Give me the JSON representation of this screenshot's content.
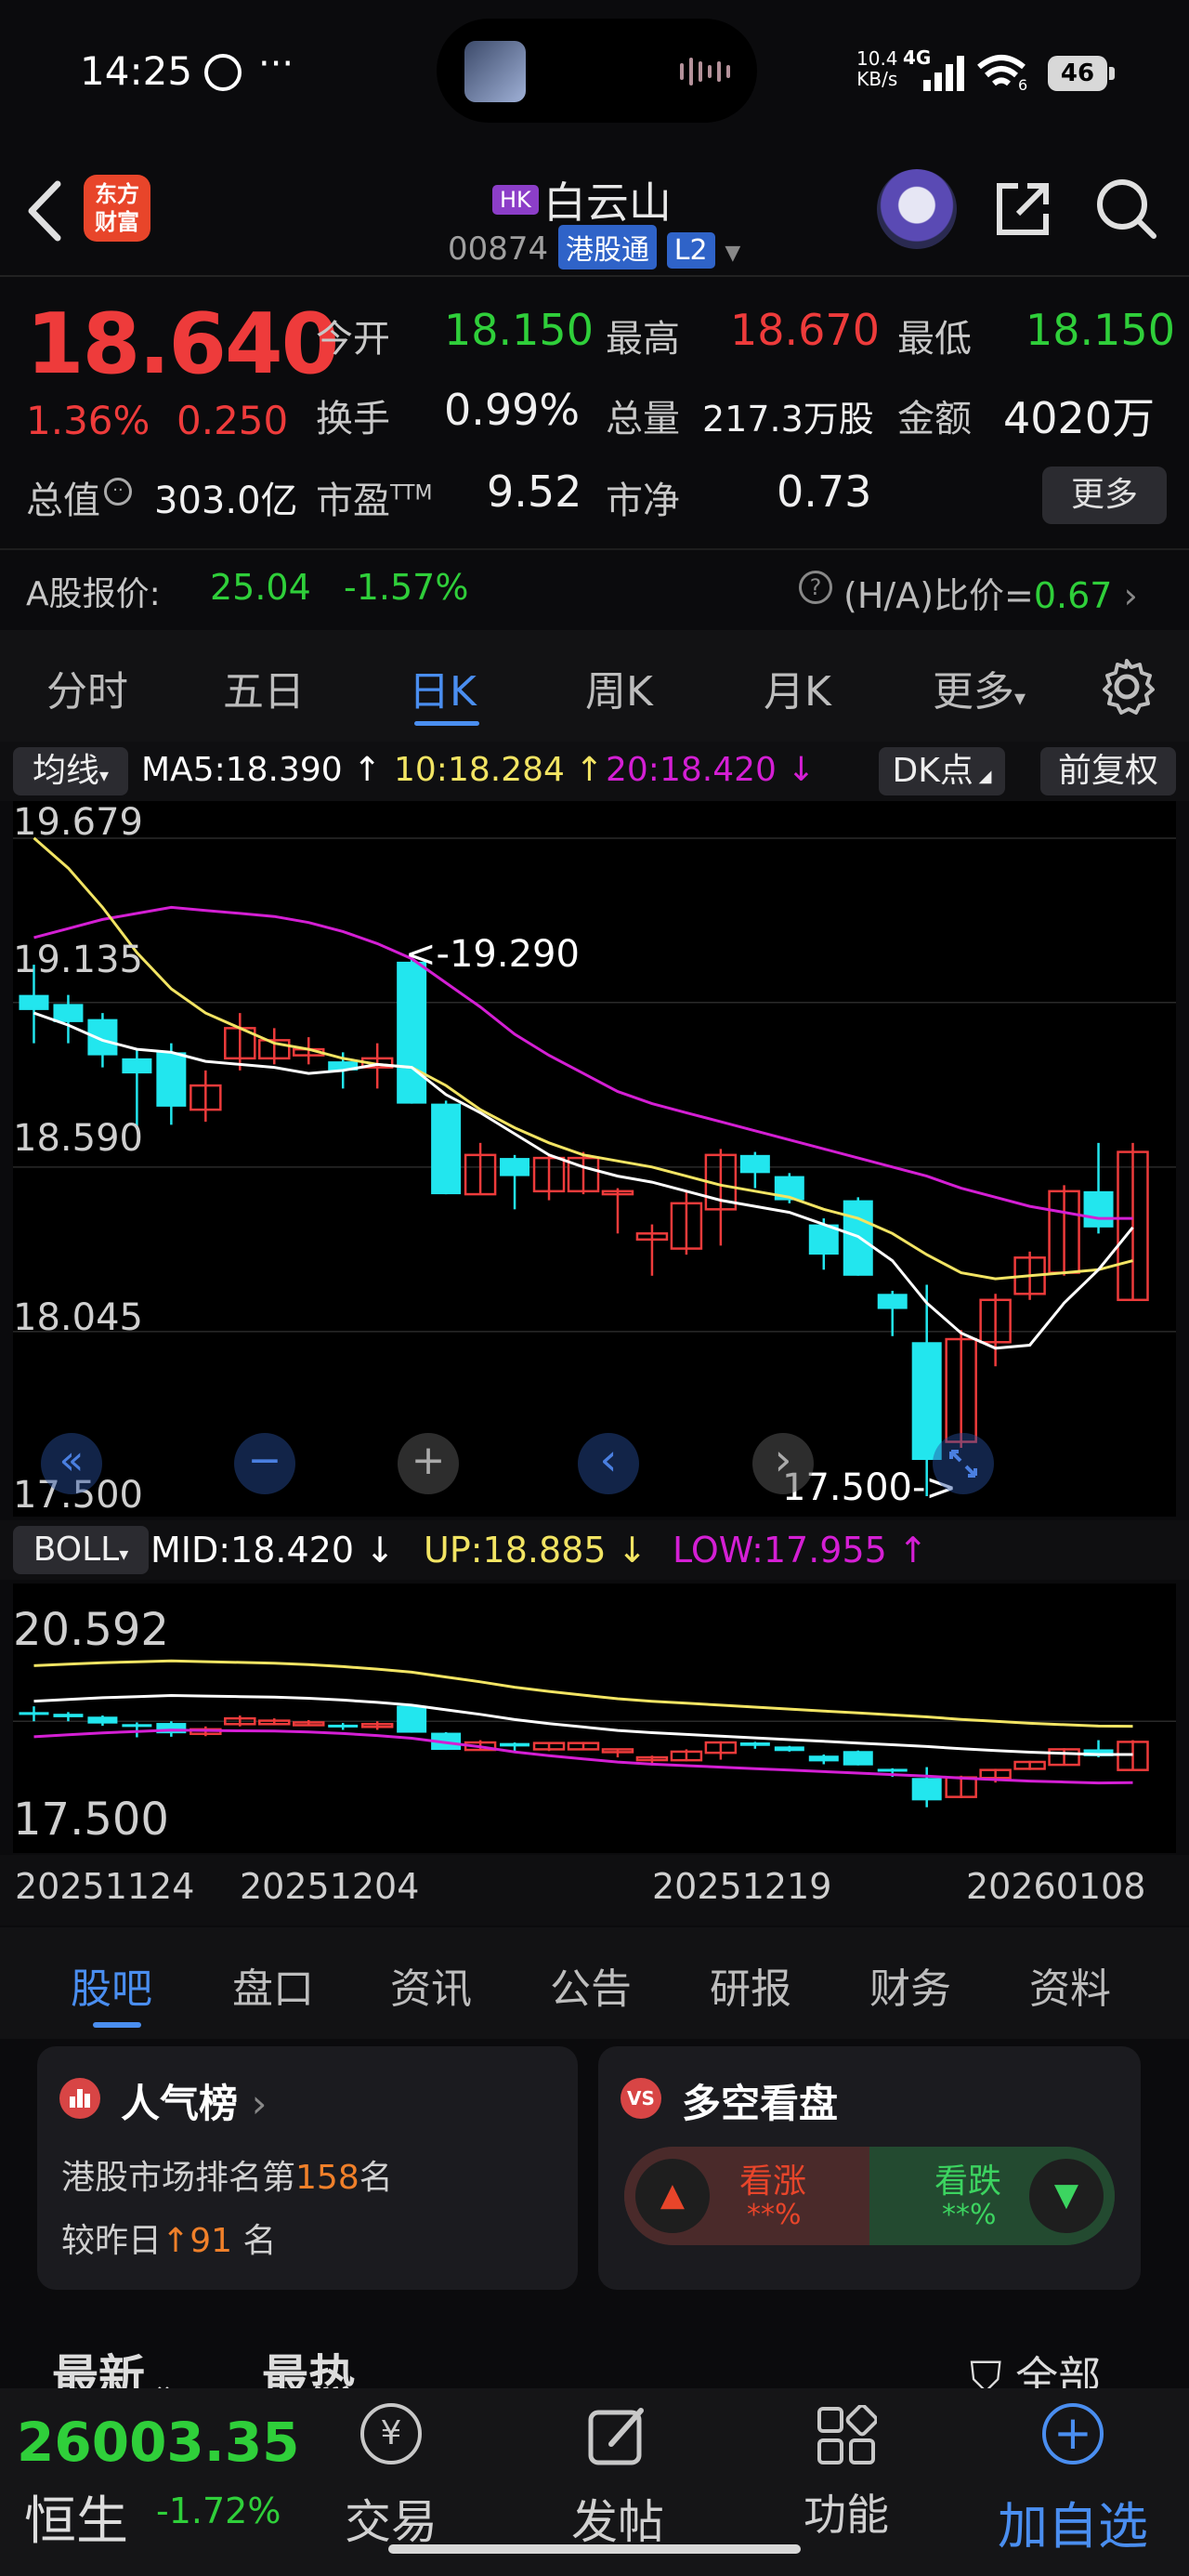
{
  "status_bar": {
    "time": "14:25",
    "dots": "···",
    "net_speed_top": "10.4",
    "net_speed_bottom": "KB/s",
    "network": "4G",
    "wifi_num": "6",
    "battery": "46"
  },
  "header": {
    "market_tag": "HK",
    "name": "白云山",
    "code": "00874",
    "connect_tag": "港股通",
    "level_tag": "L2",
    "logo_line1": "东方",
    "logo_line2": "财富"
  },
  "quote": {
    "price": "18.640",
    "change_pct": "1.36%",
    "change": "0.250",
    "open_label": "今开",
    "open": "18.150",
    "high_label": "最高",
    "high": "18.670",
    "low_label": "最低",
    "low": "18.150",
    "turnover_label": "换手",
    "turnover": "0.99%",
    "volume_label": "总量",
    "volume": "217.3万股",
    "amount_label": "金额",
    "amount": "4020万",
    "mktcap_label": "总值",
    "mktcap": "303.0亿",
    "pe_label": "市盈",
    "pe_sup": "TTM",
    "pe": "9.52",
    "pb_label": "市净",
    "pb": "0.73",
    "more": "更多",
    "a_share_label": "A股报价:",
    "a_share_price": "25.04",
    "a_share_pct": "-1.57%",
    "ha_ratio": "(H/A)比价=",
    "ha_value": "0.67"
  },
  "chart_tabs": [
    "分时",
    "五日",
    "日K",
    "周K",
    "月K",
    "更多"
  ],
  "active_chart_tab": 2,
  "ma_bar": {
    "selector": "均线",
    "ma5": "MA5:18.390",
    "ma10": "10:18.284",
    "ma20": "20:18.420",
    "dk": "DK点",
    "adjust": "前复权"
  },
  "colors": {
    "up": "#ee3b3b",
    "down": "#22e6ee",
    "ma5": "#ffffff",
    "ma10": "#f2e463",
    "ma20": "#d41fd4",
    "accent": "#4a8ef0"
  },
  "chart_data": {
    "type": "candlestick",
    "y_labels": [
      "19.679",
      "19.135",
      "18.590",
      "18.045",
      "17.500"
    ],
    "ylim": [
      17.5,
      19.679
    ],
    "max_annotation": "<-19.290",
    "min_annotation": "17.500->",
    "candles": [
      {
        "o": 19.16,
        "c": 19.11,
        "h": 19.26,
        "l": 19.0
      },
      {
        "o": 19.13,
        "c": 19.07,
        "h": 19.16,
        "l": 19.0
      },
      {
        "o": 19.08,
        "c": 18.96,
        "h": 19.1,
        "l": 18.92
      },
      {
        "o": 18.95,
        "c": 18.9,
        "h": 18.98,
        "l": 18.72
      },
      {
        "o": 18.97,
        "c": 18.79,
        "h": 19.0,
        "l": 18.73
      },
      {
        "o": 18.78,
        "c": 18.86,
        "h": 18.91,
        "l": 18.74
      },
      {
        "o": 18.95,
        "c": 19.05,
        "h": 19.1,
        "l": 18.91
      },
      {
        "o": 18.95,
        "c": 19.01,
        "h": 19.05,
        "l": 18.93
      },
      {
        "o": 18.96,
        "c": 18.98,
        "h": 19.02,
        "l": 18.93
      },
      {
        "o": 18.94,
        "c": 18.91,
        "h": 18.97,
        "l": 18.85
      },
      {
        "o": 18.92,
        "c": 18.95,
        "h": 19.0,
        "l": 18.85
      },
      {
        "o": 19.27,
        "c": 18.8,
        "h": 19.29,
        "l": 18.8
      },
      {
        "o": 18.8,
        "c": 18.5,
        "h": 18.81,
        "l": 18.5
      },
      {
        "o": 18.5,
        "c": 18.63,
        "h": 18.67,
        "l": 18.5
      },
      {
        "o": 18.62,
        "c": 18.56,
        "h": 18.63,
        "l": 18.45
      },
      {
        "o": 18.51,
        "c": 18.62,
        "h": 18.63,
        "l": 18.48
      },
      {
        "o": 18.51,
        "c": 18.62,
        "h": 18.64,
        "l": 18.5
      },
      {
        "o": 18.5,
        "c": 18.51,
        "h": 18.52,
        "l": 18.37
      },
      {
        "o": 18.35,
        "c": 18.37,
        "h": 18.4,
        "l": 18.23
      },
      {
        "o": 18.32,
        "c": 18.47,
        "h": 18.51,
        "l": 18.3
      },
      {
        "o": 18.45,
        "c": 18.63,
        "h": 18.65,
        "l": 18.33
      },
      {
        "o": 18.63,
        "c": 18.57,
        "h": 18.64,
        "l": 18.52
      },
      {
        "o": 18.56,
        "c": 18.48,
        "h": 18.57,
        "l": 18.47
      },
      {
        "o": 18.4,
        "c": 18.3,
        "h": 18.42,
        "l": 18.25
      },
      {
        "o": 18.48,
        "c": 18.23,
        "h": 18.49,
        "l": 18.23
      },
      {
        "o": 18.17,
        "c": 18.12,
        "h": 18.18,
        "l": 18.03
      },
      {
        "o": 18.01,
        "c": 17.62,
        "h": 18.2,
        "l": 17.5
      },
      {
        "o": 17.68,
        "c": 18.02,
        "h": 18.05,
        "l": 17.66
      },
      {
        "o": 18.01,
        "c": 18.15,
        "h": 18.17,
        "l": 17.93
      },
      {
        "o": 18.17,
        "c": 18.29,
        "h": 18.31,
        "l": 18.15
      },
      {
        "o": 18.24,
        "c": 18.51,
        "h": 18.53,
        "l": 18.23
      },
      {
        "o": 18.51,
        "c": 18.39,
        "h": 18.67,
        "l": 18.37
      },
      {
        "o": 18.15,
        "c": 18.64,
        "h": 18.67,
        "l": 18.15
      }
    ],
    "ma5": [
      19.1,
      19.06,
      19.01,
      18.98,
      18.97,
      18.94,
      18.93,
      18.92,
      18.9,
      18.91,
      18.93,
      18.92,
      18.83,
      18.77,
      18.7,
      18.63,
      18.59,
      18.56,
      18.54,
      18.51,
      18.48,
      18.46,
      18.44,
      18.4,
      18.36,
      18.28,
      18.14,
      18.04,
      17.99,
      18.0,
      18.14,
      18.25,
      18.39
    ],
    "ma10": [
      19.68,
      19.58,
      19.45,
      19.3,
      19.18,
      19.1,
      19.05,
      19.0,
      18.98,
      18.95,
      18.93,
      18.92,
      18.86,
      18.78,
      18.72,
      18.67,
      18.63,
      18.61,
      18.59,
      18.56,
      18.53,
      18.51,
      18.49,
      18.45,
      18.42,
      18.37,
      18.3,
      18.24,
      18.22,
      18.23,
      18.24,
      18.25,
      18.28
    ],
    "ma20": [
      19.35,
      19.38,
      19.41,
      19.43,
      19.45,
      19.44,
      19.43,
      19.42,
      19.4,
      19.37,
      19.33,
      19.28,
      19.2,
      19.12,
      19.03,
      18.96,
      18.9,
      18.84,
      18.8,
      18.77,
      18.74,
      18.71,
      18.68,
      18.65,
      18.62,
      18.59,
      18.56,
      18.52,
      18.49,
      18.46,
      18.44,
      18.42,
      18.42
    ],
    "x_labels": [
      "20251124",
      "20251204",
      "20251219",
      "20260108"
    ]
  },
  "controls": [
    "«",
    "−",
    "+",
    "‹",
    "›"
  ],
  "boll": {
    "selector": "BOLL",
    "mid": "MID:18.420",
    "up": "UP:18.885",
    "low": "LOW:17.955",
    "y_top": "20.592",
    "y_bottom": "17.500"
  },
  "section_tabs": [
    "股吧",
    "盘口",
    "资讯",
    "公告",
    "研报",
    "财务",
    "资料"
  ],
  "active_section_tab": 0,
  "popularity": {
    "title": "人气榜",
    "rank_prefix": "港股市场排名第",
    "rank": "158",
    "rank_suffix": "名",
    "compare_prefix": "较昨日",
    "compare_value": "91",
    "compare_suffix": "名"
  },
  "bull_bear": {
    "title": "多空看盘",
    "bull": "看涨",
    "bull_pct": "**%",
    "bear": "看跌",
    "bear_pct": "**%"
  },
  "feed": {
    "latest": "最新",
    "hottest": "最热",
    "filter": "全部"
  },
  "bottom_nav": {
    "index_value": "26003.35",
    "index_name": "恒生",
    "index_pct": "-1.72%",
    "trade": "交易",
    "post": "发帖",
    "function": "功能",
    "add_watch": "加自选"
  }
}
